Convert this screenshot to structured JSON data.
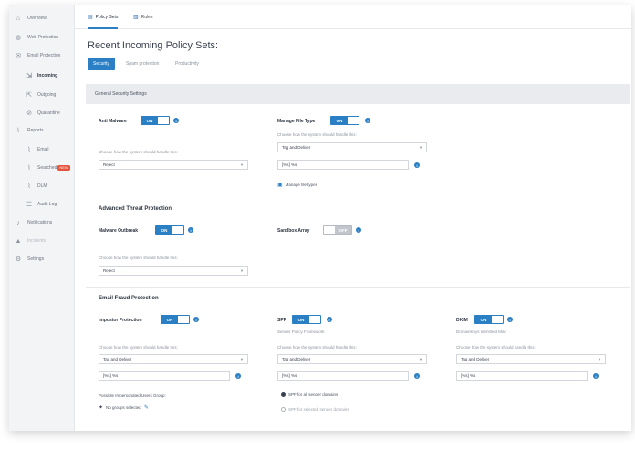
{
  "sidebar": {
    "items": [
      {
        "label": "Overview",
        "icon": "home-icon"
      },
      {
        "label": "Web Protection",
        "icon": "globe-icon"
      },
      {
        "label": "Email Protection",
        "icon": "mail-icon"
      },
      {
        "label": "Incoming",
        "icon": "inbox-icon"
      },
      {
        "label": "Outgoing",
        "icon": "outbox-icon"
      },
      {
        "label": "Quarantine",
        "icon": "quarantine-icon"
      },
      {
        "label": "Reports",
        "icon": "chart-icon"
      },
      {
        "label": "Email",
        "icon": "chart-icon"
      },
      {
        "label": "Searched",
        "icon": "chart-icon",
        "badge": "NEW"
      },
      {
        "label": "DLM",
        "icon": "chart-icon"
      },
      {
        "label": "Audit Log",
        "icon": "list-icon"
      },
      {
        "label": "Notifications",
        "icon": "bell-icon"
      },
      {
        "label": "Incidents",
        "icon": "warning-icon"
      },
      {
        "label": "Settings",
        "icon": "gear-icon"
      }
    ]
  },
  "topbar": {
    "tabs": [
      {
        "label": "Policy Sets",
        "icon": "policy-icon"
      },
      {
        "label": "Rules",
        "icon": "rules-icon"
      }
    ]
  },
  "page": {
    "title": "Recent Incoming Policy Sets:",
    "subtabs": [
      "Security",
      "Spam protection",
      "Productivity"
    ]
  },
  "general": {
    "header": "General Security Settings",
    "anti_malware": {
      "label": "Anti Malware",
      "toggle": "ON",
      "help": "Choose how the system should handle this:",
      "action": "Reject"
    },
    "manage_file_type": {
      "label": "Manage File Type",
      "toggle": "ON",
      "help": "Choose how the system should handle this:",
      "action": "Tag and Deliver",
      "tag": "[%s] %s",
      "link": "Manage file types"
    }
  },
  "atp": {
    "heading": "Advanced Threat Protection",
    "malware_outbreak": {
      "label": "Malware Outbreak",
      "toggle": "ON",
      "help": "Choose how the system should handle this:",
      "action": "Reject"
    },
    "sandbox_array": {
      "label": "Sandbox Array",
      "toggle": "OFF"
    }
  },
  "fraud": {
    "heading": "Email Fraud Protection",
    "impostor": {
      "label": "Impostor Protection",
      "toggle": "ON",
      "help": "Choose how the system should handle this:",
      "action": "Tag and Deliver",
      "tag": "[%s] %s",
      "groups_label": "Possible Impersonated Users Group:",
      "groups_value": "No groups selected"
    },
    "spf": {
      "label": "SPF",
      "toggle": "ON",
      "sub": "Sender Policy Framework",
      "help": "Choose how the system should handle this:",
      "action": "Tag and Deliver",
      "tag": "[%s] %s",
      "radio_all": "SPF for all sender domains",
      "radio_selected": "SPF for selected sender domains"
    },
    "dkim": {
      "label": "DKIM",
      "toggle": "ON",
      "sub": "DomainKeys Identified Mail",
      "help": "Choose how the system should handle this:",
      "action": "Tag and Deliver",
      "tag": "[%s] %s"
    }
  },
  "colors": {
    "accent": "#2b7fc4",
    "badge": "#e5533d"
  }
}
